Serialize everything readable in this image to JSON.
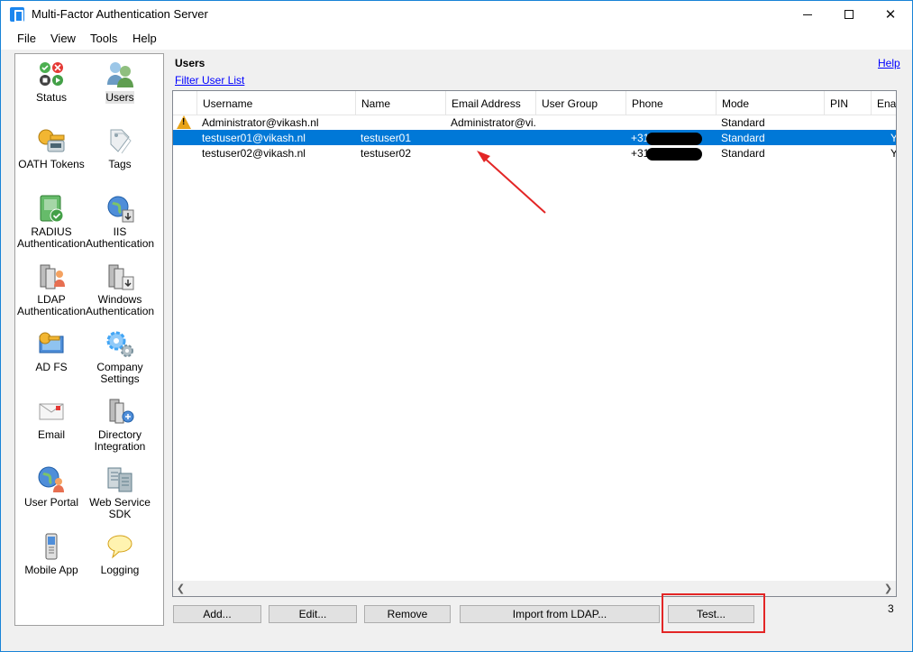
{
  "window": {
    "title": "Multi-Factor Authentication Server",
    "close_glyph": "✕"
  },
  "menu": [
    "File",
    "View",
    "Tools",
    "Help"
  ],
  "nav": [
    {
      "label": "Status",
      "icon": "status-icon"
    },
    {
      "label": "Users",
      "icon": "users-icon",
      "selected": true
    },
    {
      "label": "OATH Tokens",
      "icon": "oath-tokens-icon"
    },
    {
      "label": "Tags",
      "icon": "tags-icon"
    },
    {
      "label": "RADIUS Authentication",
      "icon": "radius-icon"
    },
    {
      "label": "IIS Authentication",
      "icon": "iis-icon"
    },
    {
      "label": "LDAP Authentication",
      "icon": "ldap-icon"
    },
    {
      "label": "Windows Authentication",
      "icon": "windows-auth-icon"
    },
    {
      "label": "AD FS",
      "icon": "adfs-icon"
    },
    {
      "label": "Company Settings",
      "icon": "company-settings-icon"
    },
    {
      "label": "Email",
      "icon": "email-icon"
    },
    {
      "label": "Directory Integration",
      "icon": "directory-integration-icon"
    },
    {
      "label": "User Portal",
      "icon": "user-portal-icon"
    },
    {
      "label": "Web Service SDK",
      "icon": "web-service-sdk-icon"
    },
    {
      "label": "Mobile App",
      "icon": "mobile-app-icon"
    },
    {
      "label": "Logging",
      "icon": "logging-icon"
    }
  ],
  "main": {
    "title": "Users",
    "filter_link": "Filter User List",
    "help_link": "Help",
    "columns": [
      "Username",
      "Name",
      "Email Address",
      "User Group",
      "Phone",
      "Mode",
      "PIN",
      "Enab"
    ],
    "rows": [
      {
        "warning": true,
        "username": "Administrator@vikash.nl",
        "name": "",
        "email": "Administrator@vi...",
        "group": "",
        "phone_prefix": "",
        "mode": "Standard",
        "pin": "",
        "enabled": ""
      },
      {
        "warning": false,
        "selected": true,
        "username": "testuser01@vikash.nl",
        "name": "testuser01",
        "email": "",
        "group": "",
        "phone_prefix": "+31",
        "mode": "Standard",
        "pin": "",
        "enabled": "Y"
      },
      {
        "warning": false,
        "username": "testuser02@vikash.nl",
        "name": "testuser02",
        "email": "",
        "group": "",
        "phone_prefix": "+31",
        "mode": "Standard",
        "pin": "",
        "enabled": "Y"
      }
    ],
    "count": "3"
  },
  "buttons": {
    "add": "Add...",
    "edit": "Edit...",
    "remove": "Remove",
    "import_ldap": "Import from LDAP...",
    "test": "Test..."
  },
  "colors": {
    "selection": "#0078d7",
    "annotation": "#e32626",
    "link": "#0000ff"
  }
}
